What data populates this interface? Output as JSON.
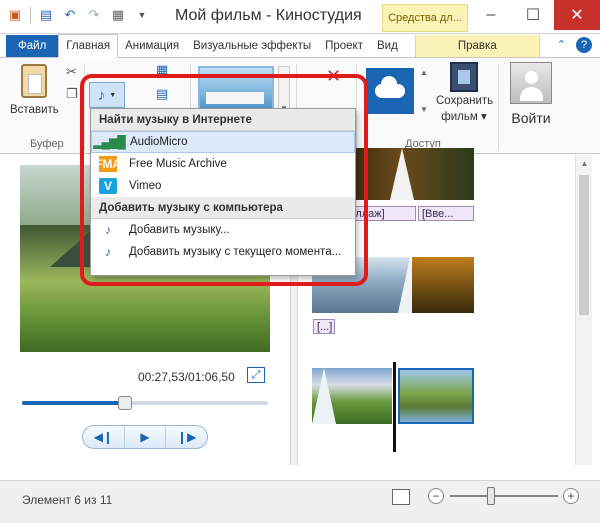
{
  "window": {
    "title": "Мой фильм - Киностудия",
    "context_title": "Средства дл..."
  },
  "tabs": [
    {
      "label": "Файл"
    },
    {
      "label": "Главная"
    },
    {
      "label": "Анимация"
    },
    {
      "label": "Визуальные эффекты"
    },
    {
      "label": "Проект"
    },
    {
      "label": "Вид"
    },
    {
      "label": "Правка"
    }
  ],
  "ribbon": {
    "paste_label": "Вставить",
    "group_clipboard": "Буфер",
    "group_share": "Доступ",
    "save_label_1": "Сохранить",
    "save_label_2": "фильм ▾",
    "signin_label": "Войти"
  },
  "music_menu": {
    "online_header": "Найти музыку в Интернете",
    "online_items": [
      "AudioMicro",
      "Free Music Archive",
      "Vimeo"
    ],
    "local_header": "Добавить музыку с компьютера",
    "local_items": [
      "Добавить музыку...",
      "Добавить музыку с текущего момента..."
    ],
    "fma_icon_text": "FMA",
    "vimeo_icon_text": "V"
  },
  "preview": {
    "timecode": "00:27,53/01:06,50",
    "seek_position": 0.42
  },
  "storyboard": {
    "caption_1": "[Коллаж]",
    "caption_2": "[Вве...",
    "caption_3": "[...]"
  },
  "status": {
    "text": "Элемент 6 из 11",
    "zoom_level": 0.38
  },
  "colors": {
    "accent": "#1a66b5",
    "highlight_frame": "#e01b1b",
    "context_tab": "#fbf4b6"
  }
}
